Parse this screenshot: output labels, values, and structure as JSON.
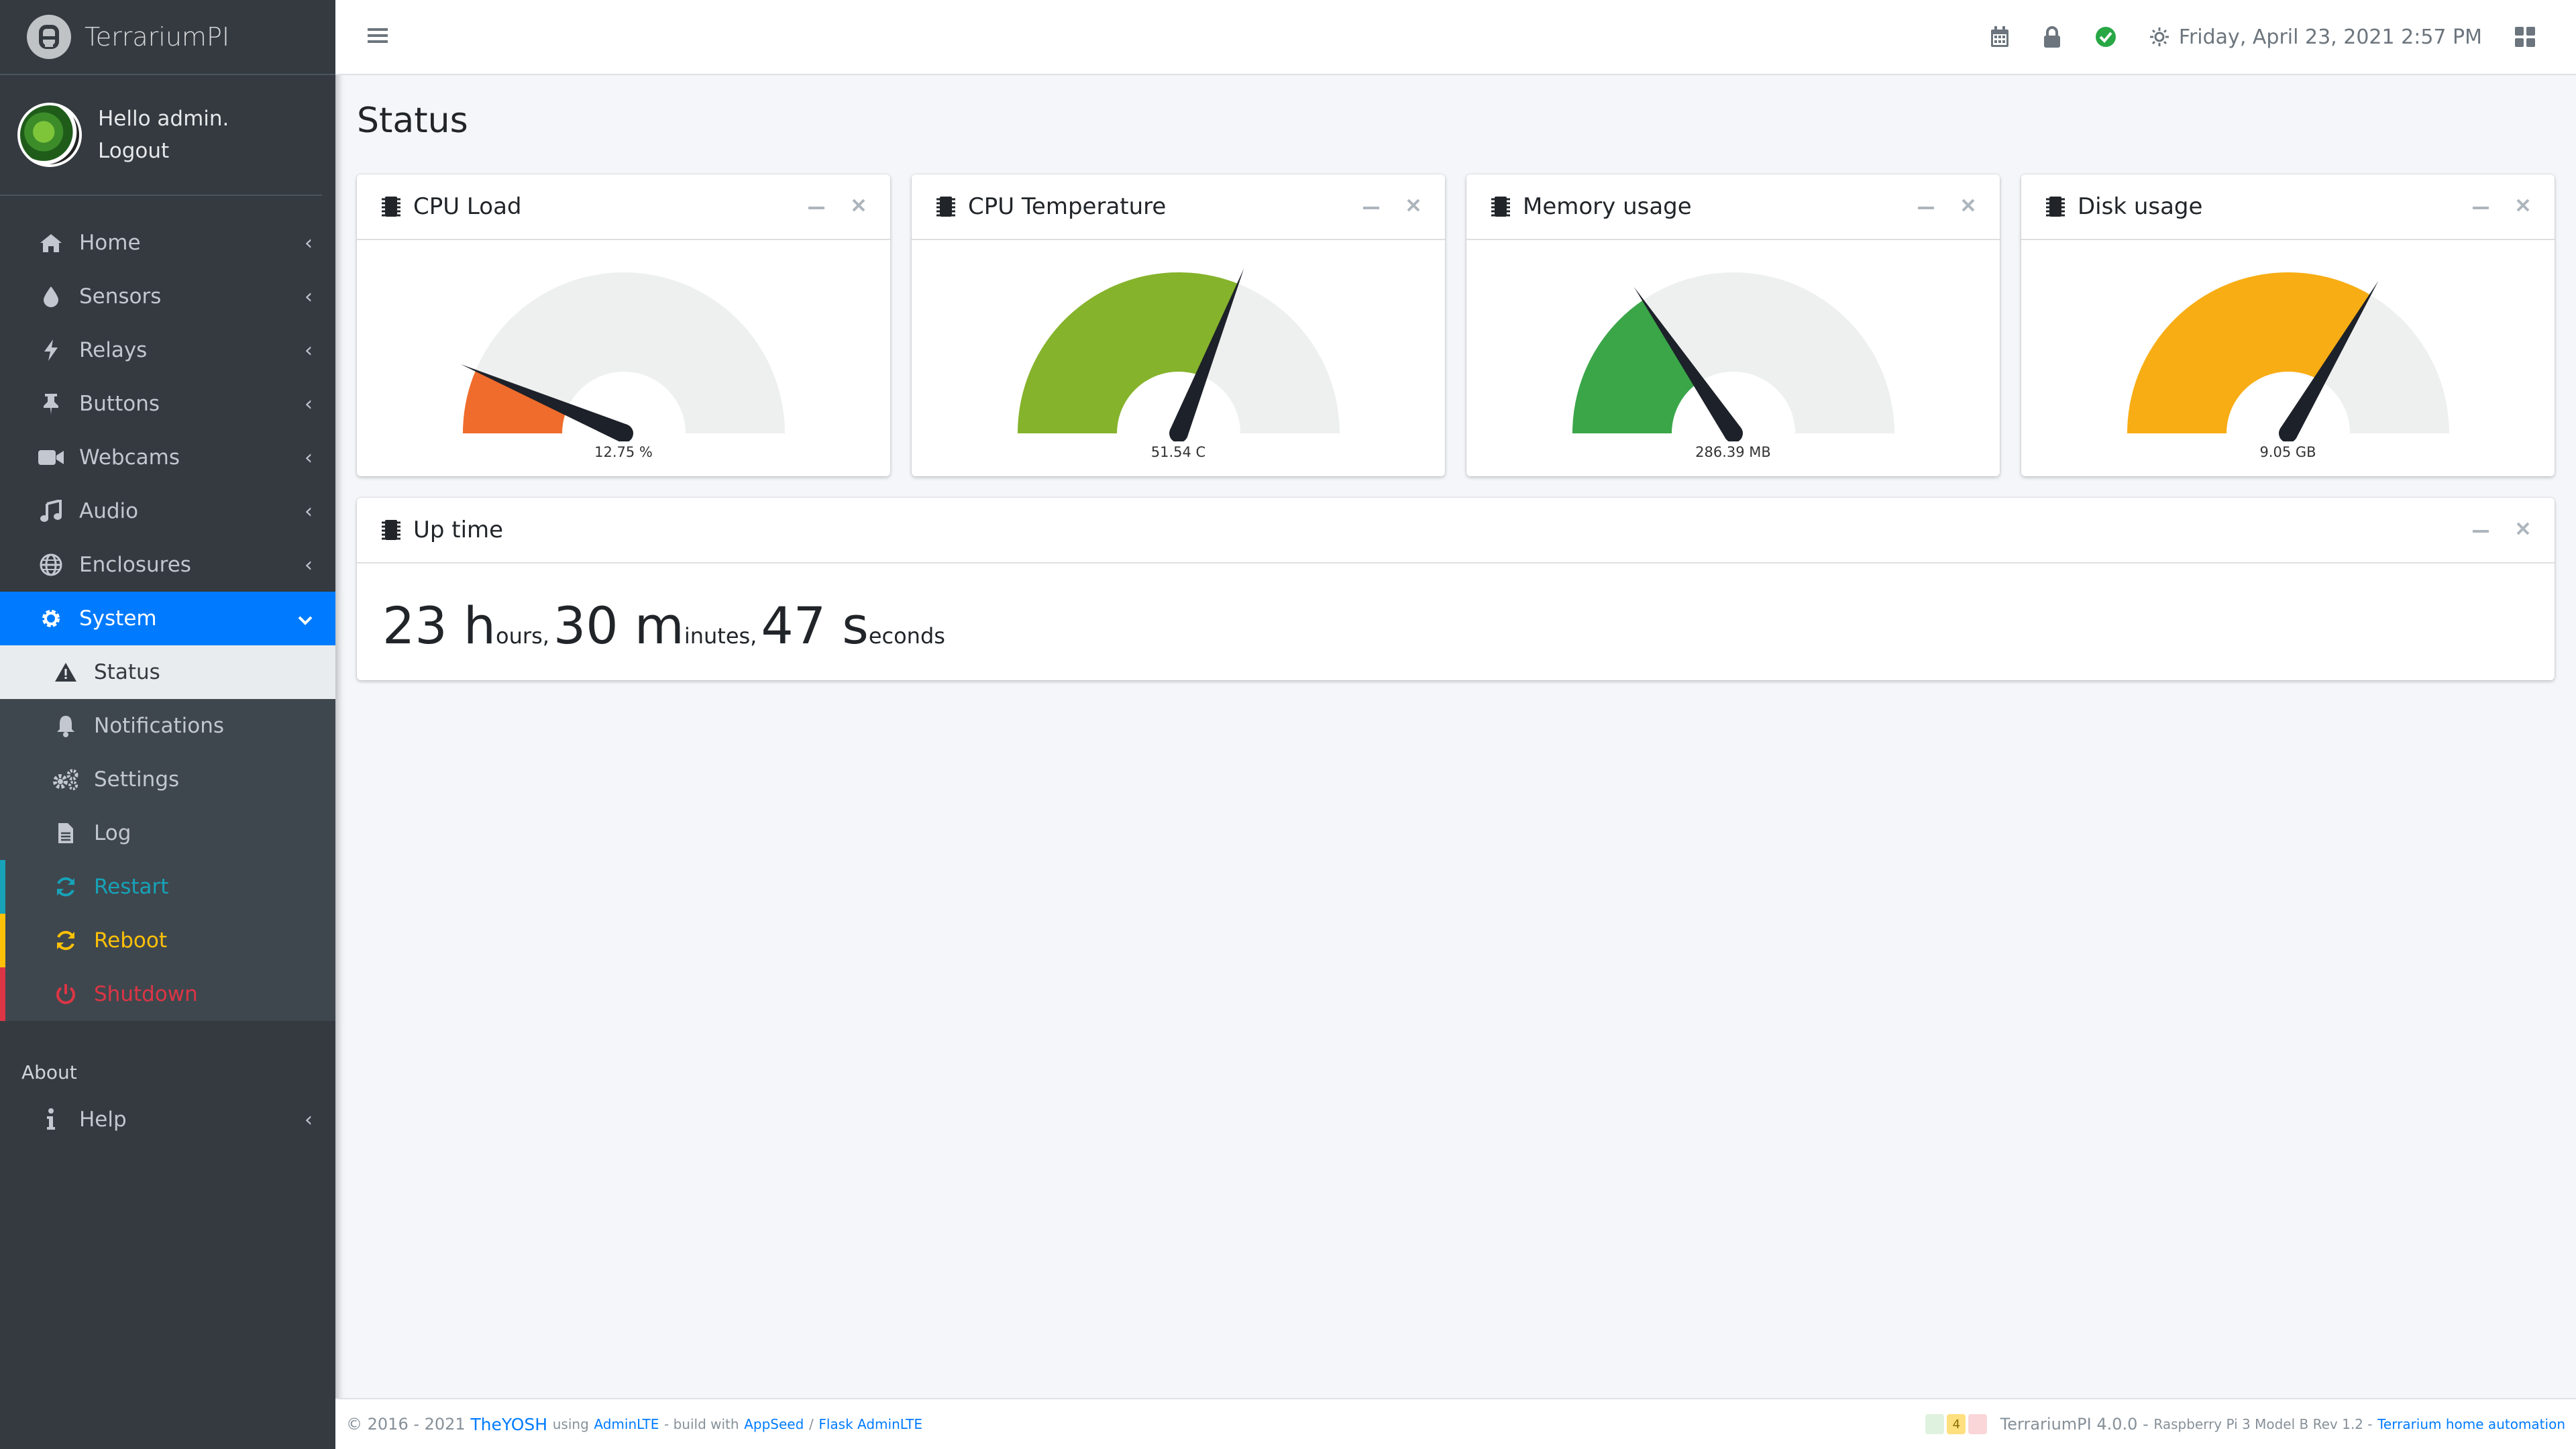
{
  "brand": {
    "name": "TerrariumPI"
  },
  "user": {
    "greeting": "Hello admin.",
    "logout": "Logout"
  },
  "nav": {
    "items": [
      {
        "label": "Home"
      },
      {
        "label": "Sensors"
      },
      {
        "label": "Relays"
      },
      {
        "label": "Buttons"
      },
      {
        "label": "Webcams"
      },
      {
        "label": "Audio"
      },
      {
        "label": "Enclosures"
      },
      {
        "label": "System"
      }
    ],
    "system_sub": [
      {
        "label": "Status"
      },
      {
        "label": "Notifications"
      },
      {
        "label": "Settings"
      },
      {
        "label": "Log"
      },
      {
        "label": "Restart"
      },
      {
        "label": "Reboot"
      },
      {
        "label": "Shutdown"
      }
    ],
    "about_header": "About",
    "help": "Help"
  },
  "topbar": {
    "datetime": "Friday, April 23, 2021 2:57 PM"
  },
  "page": {
    "title": "Status"
  },
  "gauges": [
    {
      "title": "CPU Load",
      "value_text": "12.75 %",
      "fraction": 0.1275,
      "color": "#ef6c2c"
    },
    {
      "title": "CPU Temperature",
      "value_text": "51.54 C",
      "fraction": 0.62,
      "color": "#85b32b"
    },
    {
      "title": "Memory usage",
      "value_text": "286.39 MB",
      "fraction": 0.31,
      "color": "#3aa648"
    },
    {
      "title": "Disk usage",
      "value_text": "9.05 GB",
      "fraction": 0.67,
      "color": "#f8ad14"
    }
  ],
  "uptime": {
    "title": "Up time",
    "hours": "23 h",
    "hours_unit": "ours,",
    "minutes": "30 m",
    "minutes_unit": "inutes,",
    "seconds": "47 s",
    "seconds_unit": "econds"
  },
  "footer": {
    "copyright": "© 2016 - 2021",
    "author": "TheYOSH",
    "using": "using",
    "adminlte": "AdminLTE",
    "build_with": "- build with",
    "appseed": "AppSeed",
    "slash": "/",
    "flask_adminlte": "Flask AdminLTE",
    "badge_count": "4",
    "version": "TerrariumPI 4.0.0",
    "dash": "-",
    "hardware": "Raspberry Pi 3 Model B Rev 1.2 -",
    "project_link": "Terrarium home automation"
  },
  "colors": {
    "accent": "#007bff",
    "sidebar_bg": "#343a40",
    "restart": "#17a2b8",
    "reboot": "#ffc107",
    "shutdown": "#dc3545"
  }
}
